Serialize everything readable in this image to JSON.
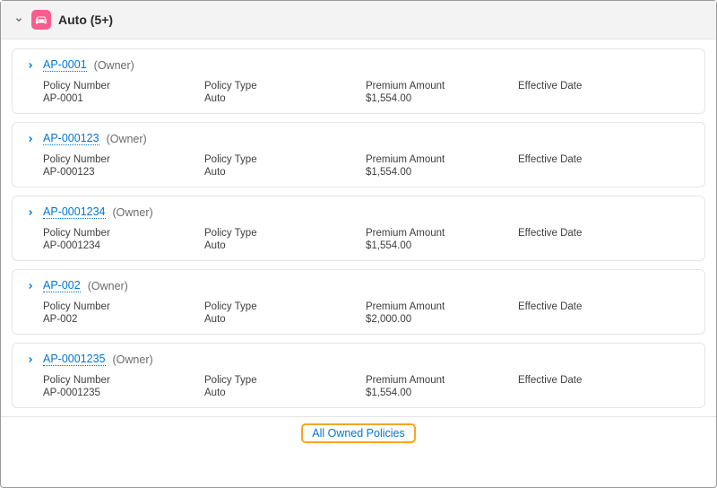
{
  "header": {
    "title": "Auto (5+)",
    "icon_name": "car-icon"
  },
  "labels": {
    "policy_number": "Policy Number",
    "policy_type": "Policy Type",
    "premium_amount": "Premium Amount",
    "effective_date": "Effective Date",
    "owner": "(Owner)"
  },
  "policies": [
    {
      "id": "AP-0001",
      "number": "AP-0001",
      "type": "Auto",
      "premium": "$1,554.00",
      "effective": ""
    },
    {
      "id": "AP-000123",
      "number": "AP-000123",
      "type": "Auto",
      "premium": "$1,554.00",
      "effective": ""
    },
    {
      "id": "AP-0001234",
      "number": "AP-0001234",
      "type": "Auto",
      "premium": "$1,554.00",
      "effective": ""
    },
    {
      "id": "AP-002",
      "number": "AP-002",
      "type": "Auto",
      "premium": "$2,000.00",
      "effective": ""
    },
    {
      "id": "AP-0001235",
      "number": "AP-0001235",
      "type": "Auto",
      "premium": "$1,554.00",
      "effective": ""
    }
  ],
  "footer": {
    "all_owned_label": "All Owned Policies"
  }
}
